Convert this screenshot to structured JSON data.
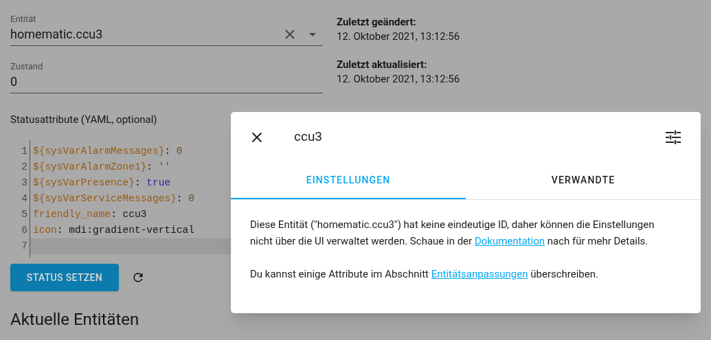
{
  "entity_field": {
    "label": "Entität",
    "value": "homematic.ccu3"
  },
  "state_field": {
    "label": "Zustand",
    "value": "0"
  },
  "last_changed": {
    "label": "Zuletzt geändert:",
    "value": "12. Oktober 2021, 13:12:56"
  },
  "last_updated": {
    "label": "Zuletzt aktualisiert:",
    "value": "12. Oktober 2021, 13:12:56"
  },
  "attributes_editor": {
    "label": "Statusattribute (YAML, optional)",
    "lines": [
      {
        "number": "1",
        "tokens": [
          {
            "kind": "key",
            "text": "${sysVarAlarmMessages}"
          },
          {
            "kind": "punct",
            "text": ": "
          },
          {
            "kind": "number",
            "text": "0"
          }
        ],
        "active": false
      },
      {
        "number": "2",
        "tokens": [
          {
            "kind": "key",
            "text": "${sysVarAlarmZone1}"
          },
          {
            "kind": "punct",
            "text": ": "
          },
          {
            "kind": "string",
            "text": "''"
          }
        ],
        "active": false
      },
      {
        "number": "3",
        "tokens": [
          {
            "kind": "key",
            "text": "${sysVarPresence}"
          },
          {
            "kind": "punct",
            "text": ": "
          },
          {
            "kind": "atom",
            "text": "true"
          }
        ],
        "active": false
      },
      {
        "number": "4",
        "tokens": [
          {
            "kind": "key",
            "text": "${sysVarServiceMessages}"
          },
          {
            "kind": "punct",
            "text": ": "
          },
          {
            "kind": "number",
            "text": "0"
          }
        ],
        "active": false
      },
      {
        "number": "5",
        "tokens": [
          {
            "kind": "key",
            "text": "friendly_name"
          },
          {
            "kind": "punct",
            "text": ": ccu3"
          }
        ],
        "active": false
      },
      {
        "number": "6",
        "tokens": [
          {
            "kind": "key",
            "text": "icon"
          },
          {
            "kind": "punct",
            "text": ": mdi:gradient-vertical"
          }
        ],
        "active": false
      },
      {
        "number": "7",
        "active": true
      }
    ]
  },
  "set_state_button": "STATUS SETZEN",
  "section_heading": "Aktuelle Entitäten",
  "dialog": {
    "title": "ccu3",
    "tabs": [
      {
        "label": "EINSTELLUNGEN",
        "selected": true
      },
      {
        "label": "VERWANDTE",
        "selected": false
      }
    ],
    "paragraphs": [
      [
        {
          "kind": "text",
          "text": "Diese Entität (\"homematic.ccu3\") hat keine eindeutige ID, daher können die Einstellungen nicht über die UI verwaltet werden. Schaue in der "
        },
        {
          "kind": "link",
          "text": "Dokumentation"
        },
        {
          "kind": "text",
          "text": " nach für mehr Details."
        }
      ],
      [
        {
          "kind": "text",
          "text": "Du kannst einige Attribute im Abschnitt "
        },
        {
          "kind": "link",
          "text": "Entitätsanpassungen"
        },
        {
          "kind": "text",
          "text": " überschreiben."
        }
      ]
    ]
  }
}
